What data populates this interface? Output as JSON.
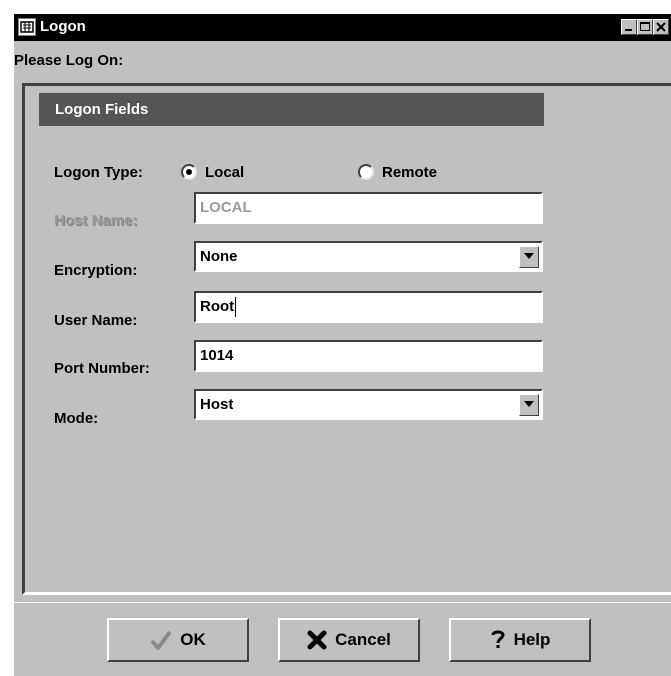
{
  "window": {
    "title": "Logon",
    "icon": "app-icon",
    "controls": [
      "minimize-icon",
      "maximize-icon",
      "close-icon"
    ]
  },
  "dialog": {
    "prompt": "Please Log On:"
  },
  "section": {
    "header": "Logon Fields"
  },
  "form": {
    "logon_type": {
      "label": "Logon Type:",
      "options": [
        {
          "label": "Local",
          "selected": true
        },
        {
          "label": "Remote",
          "selected": false
        }
      ]
    },
    "host_name": {
      "label": "Host Name:",
      "value": "LOCAL",
      "disabled": true
    },
    "encryption": {
      "label": "Encryption:",
      "value": "None"
    },
    "user_name": {
      "label": "User Name:",
      "value": "Root"
    },
    "port_number": {
      "label": "Port Number:",
      "value": "1014"
    },
    "mode": {
      "label": "Mode:",
      "value": "Host"
    }
  },
  "buttons": {
    "ok": "OK",
    "cancel": "Cancel",
    "help": "Help"
  },
  "colors": {
    "title_bar": "#000000",
    "section_header": "#555555",
    "window_bg": "#c0c0c0",
    "ok_icon": "#8a8a8a"
  }
}
